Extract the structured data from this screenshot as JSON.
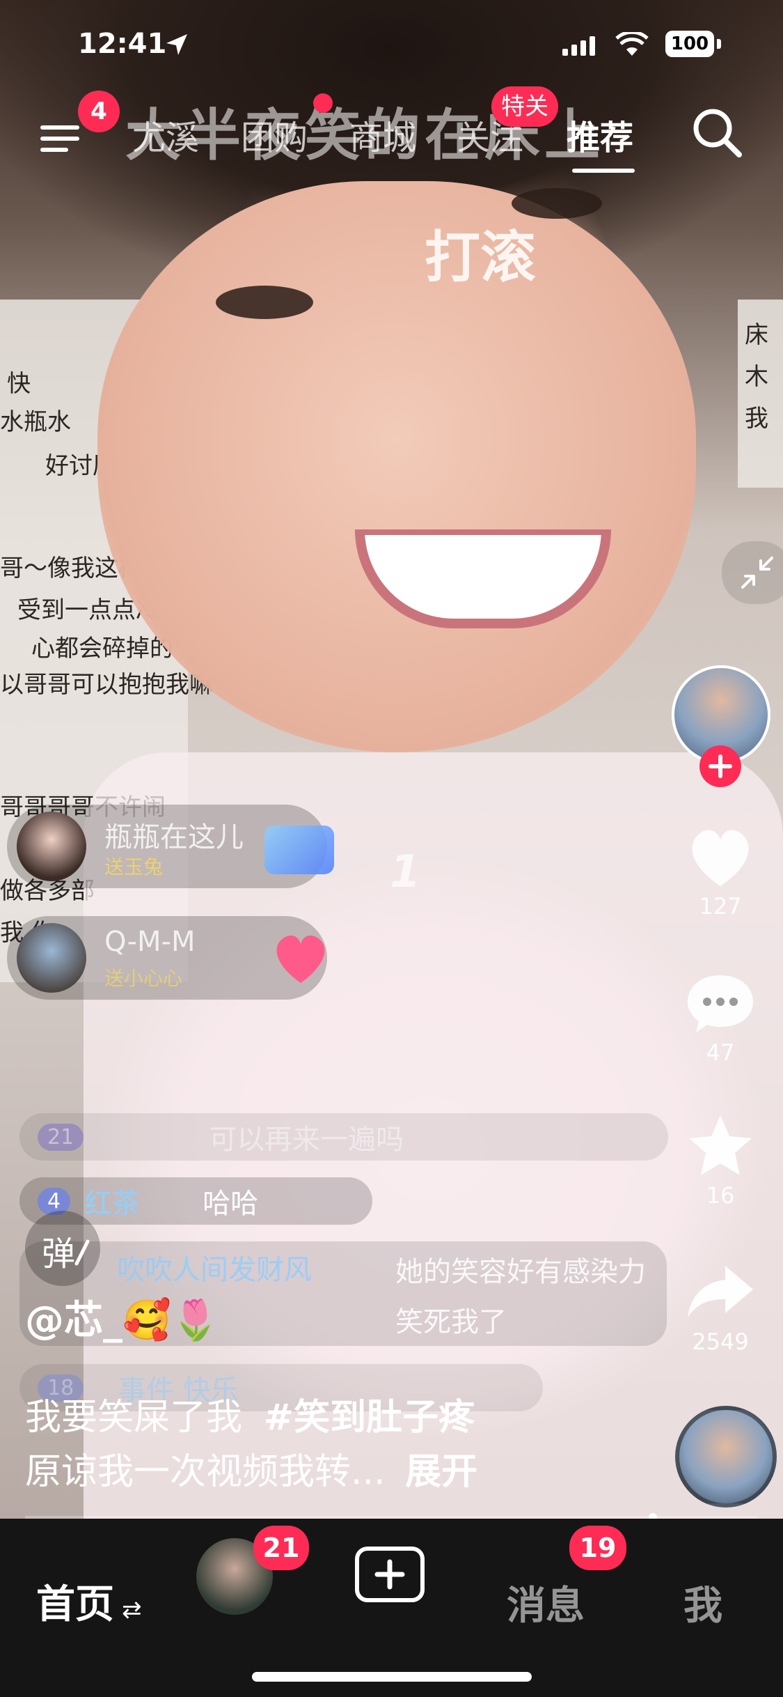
{
  "status_bar": {
    "time": "12:41",
    "battery": "100"
  },
  "top_nav": {
    "menu_badge": "4",
    "tabs": [
      {
        "label": "尤溪",
        "active": false
      },
      {
        "label": "团购",
        "active": false
      },
      {
        "label": "商城",
        "active": false
      },
      {
        "label": "关注",
        "active": false
      },
      {
        "label": "推荐",
        "active": true
      }
    ],
    "follow_badge": "特关",
    "accent_color": "#fe2c55"
  },
  "video": {
    "caption_line1": "大半夜笑的在床上",
    "caption_line2": "打滚",
    "background_note_left": [
      "快",
      "水瓶水",
      "好讨厌",
      "哥～像我这样的",
      "受到一点点冷淡",
      "心都会碎掉的",
      "以哥哥可以抱抱我嘛",
      "哥哥哥哥不许闹",
      "做各多部",
      "我 你"
    ],
    "background_note_right": [
      "床",
      "木",
      "我"
    ]
  },
  "live_gifts": [
    {
      "user": "瓶瓶在这儿",
      "sub": "送玉兔"
    },
    {
      "user": "Q-M-M",
      "sub": "送小心心"
    }
  ],
  "live_gift_count": "1",
  "danmaku": [
    {
      "level": "21",
      "name": "",
      "text": "可以再来一遍吗"
    },
    {
      "level": "4",
      "name": "红茶",
      "text": "哈哈"
    },
    {
      "level": "",
      "name": "吹吹人间发财风",
      "text": "她的笑容好有感染力 笑死我了"
    },
    {
      "level": "18",
      "name": "事件 快乐",
      "text": ""
    }
  ],
  "danmaku_button": "弹",
  "sidebar": {
    "likes": "127",
    "comments": "47",
    "favorites": "16",
    "shares": "2549"
  },
  "post": {
    "author": "@芯_",
    "author_emoji": "🥰🌷",
    "desc_line1": "我要笑屎了我",
    "hashtag": "#笑到肚子疼",
    "desc_line2": "原谅我一次视频我转...",
    "expand": "展开"
  },
  "bottom_tabs": {
    "home": "首页",
    "home_arrows": "⇄",
    "friend_badge": "21",
    "add": "+",
    "messages": "消息",
    "messages_badge": "19",
    "me": "我"
  }
}
